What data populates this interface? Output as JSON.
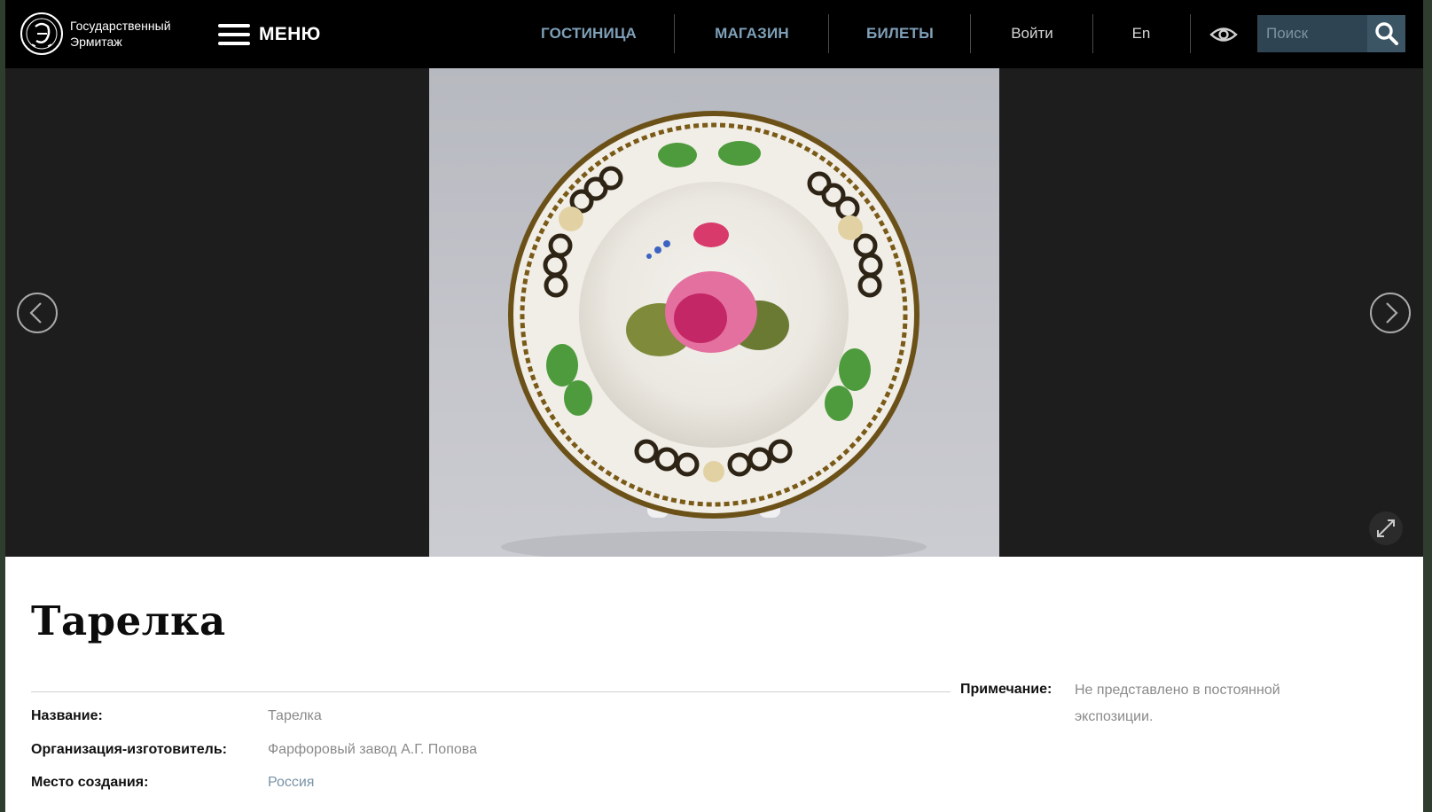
{
  "header": {
    "logo_text_line1": "Государственный",
    "logo_text_line2": "Эрмитаж",
    "logo_seal_text": "ГОСУДАРСТВЕННЫЙ ЭРМИТАЖ",
    "menu_label": "МЕНЮ",
    "nav": {
      "hotel": "ГОСТИНИЦА",
      "shop": "МАГАЗИН",
      "tickets": "БИЛЕТЫ",
      "login": "Войти",
      "lang": "En"
    },
    "search_placeholder": "Поиск",
    "icons": [
      "hamburger-icon",
      "eye-icon",
      "search-icon"
    ]
  },
  "gallery": {
    "image_subject": "Тарелка",
    "icons": [
      "chevron-left-icon",
      "chevron-right-icon",
      "expand-icon"
    ]
  },
  "item": {
    "title": "Тарелка",
    "fields": [
      {
        "label": "Название:",
        "value": "Тарелка"
      },
      {
        "label": "Организация-изготовитель:",
        "value": "Фарфоровый завод А.Г. Попова"
      },
      {
        "label": "Место создания:",
        "value": "Россия"
      }
    ],
    "note_label": "Примечание:",
    "note_value": "Не представлено в постоянной экспозиции."
  },
  "colors": {
    "header_bg": "#000000",
    "nav_accent": "#7fa0b8",
    "gallery_bg": "#1d1d1d",
    "search_bg": "#2f4452",
    "link": "#7893a8"
  }
}
